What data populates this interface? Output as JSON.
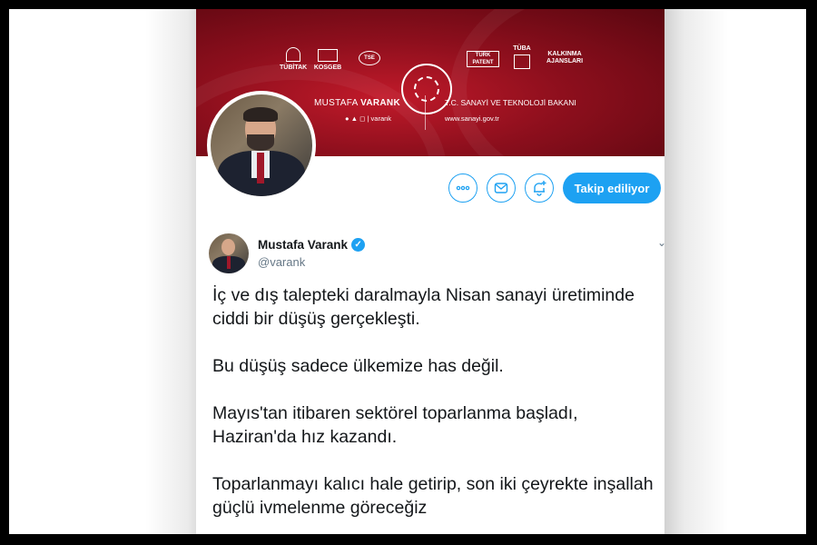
{
  "banner": {
    "logos": [
      "TÜBİTAK",
      "KOSGEB",
      "TSE",
      "TÜRK PATENT",
      "TÜBA",
      "KALKINMA AJANSLARI"
    ],
    "name_first": "MUSTAFA ",
    "name_last": "VARANK",
    "social_handle": "varank",
    "ministry": "T.C. SANAYİ VE TEKNOLOJİ BAKANI",
    "website": "www.sanayi.gov.tr"
  },
  "profile_actions": {
    "more_icon": "more-icon",
    "message_icon": "envelope-icon",
    "notify_icon": "bell-plus-icon",
    "follow_label": "Takip ediliyor"
  },
  "tweet": {
    "display_name": "Mustafa Varank",
    "handle": "@varank",
    "paragraphs": [
      "İç ve dış talepteki daralmayla Nisan sanayi üretiminde ciddi bir düşüş gerçekleşti.",
      "Bu düşüş sadece ülkemize has değil.",
      "Mayıs'tan itibaren sektörel toparlanma başladı, Haziran'da hız kazandı.",
      "Toparlanmayı kalıcı hale getirip, son iki çeyrekte inşallah güçlü ivmelenme göreceğiz"
    ]
  },
  "colors": {
    "accent": "#1da1f2",
    "banner_red": "#a3111f"
  }
}
